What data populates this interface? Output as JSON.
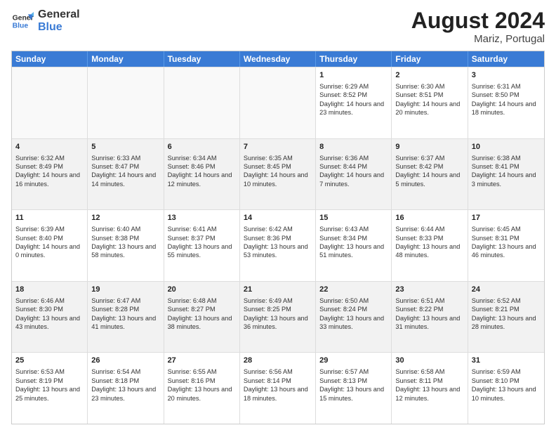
{
  "header": {
    "logo": "GeneralBlue",
    "month_year": "August 2024",
    "location": "Mariz, Portugal"
  },
  "days_of_week": [
    "Sunday",
    "Monday",
    "Tuesday",
    "Wednesday",
    "Thursday",
    "Friday",
    "Saturday"
  ],
  "rows": [
    [
      {
        "day": "",
        "info": ""
      },
      {
        "day": "",
        "info": ""
      },
      {
        "day": "",
        "info": ""
      },
      {
        "day": "",
        "info": ""
      },
      {
        "day": "1",
        "info": "Sunrise: 6:29 AM\nSunset: 8:52 PM\nDaylight: 14 hours and 23 minutes."
      },
      {
        "day": "2",
        "info": "Sunrise: 6:30 AM\nSunset: 8:51 PM\nDaylight: 14 hours and 20 minutes."
      },
      {
        "day": "3",
        "info": "Sunrise: 6:31 AM\nSunset: 8:50 PM\nDaylight: 14 hours and 18 minutes."
      }
    ],
    [
      {
        "day": "4",
        "info": "Sunrise: 6:32 AM\nSunset: 8:49 PM\nDaylight: 14 hours and 16 minutes."
      },
      {
        "day": "5",
        "info": "Sunrise: 6:33 AM\nSunset: 8:47 PM\nDaylight: 14 hours and 14 minutes."
      },
      {
        "day": "6",
        "info": "Sunrise: 6:34 AM\nSunset: 8:46 PM\nDaylight: 14 hours and 12 minutes."
      },
      {
        "day": "7",
        "info": "Sunrise: 6:35 AM\nSunset: 8:45 PM\nDaylight: 14 hours and 10 minutes."
      },
      {
        "day": "8",
        "info": "Sunrise: 6:36 AM\nSunset: 8:44 PM\nDaylight: 14 hours and 7 minutes."
      },
      {
        "day": "9",
        "info": "Sunrise: 6:37 AM\nSunset: 8:42 PM\nDaylight: 14 hours and 5 minutes."
      },
      {
        "day": "10",
        "info": "Sunrise: 6:38 AM\nSunset: 8:41 PM\nDaylight: 14 hours and 3 minutes."
      }
    ],
    [
      {
        "day": "11",
        "info": "Sunrise: 6:39 AM\nSunset: 8:40 PM\nDaylight: 14 hours and 0 minutes."
      },
      {
        "day": "12",
        "info": "Sunrise: 6:40 AM\nSunset: 8:38 PM\nDaylight: 13 hours and 58 minutes."
      },
      {
        "day": "13",
        "info": "Sunrise: 6:41 AM\nSunset: 8:37 PM\nDaylight: 13 hours and 55 minutes."
      },
      {
        "day": "14",
        "info": "Sunrise: 6:42 AM\nSunset: 8:36 PM\nDaylight: 13 hours and 53 minutes."
      },
      {
        "day": "15",
        "info": "Sunrise: 6:43 AM\nSunset: 8:34 PM\nDaylight: 13 hours and 51 minutes."
      },
      {
        "day": "16",
        "info": "Sunrise: 6:44 AM\nSunset: 8:33 PM\nDaylight: 13 hours and 48 minutes."
      },
      {
        "day": "17",
        "info": "Sunrise: 6:45 AM\nSunset: 8:31 PM\nDaylight: 13 hours and 46 minutes."
      }
    ],
    [
      {
        "day": "18",
        "info": "Sunrise: 6:46 AM\nSunset: 8:30 PM\nDaylight: 13 hours and 43 minutes."
      },
      {
        "day": "19",
        "info": "Sunrise: 6:47 AM\nSunset: 8:28 PM\nDaylight: 13 hours and 41 minutes."
      },
      {
        "day": "20",
        "info": "Sunrise: 6:48 AM\nSunset: 8:27 PM\nDaylight: 13 hours and 38 minutes."
      },
      {
        "day": "21",
        "info": "Sunrise: 6:49 AM\nSunset: 8:25 PM\nDaylight: 13 hours and 36 minutes."
      },
      {
        "day": "22",
        "info": "Sunrise: 6:50 AM\nSunset: 8:24 PM\nDaylight: 13 hours and 33 minutes."
      },
      {
        "day": "23",
        "info": "Sunrise: 6:51 AM\nSunset: 8:22 PM\nDaylight: 13 hours and 31 minutes."
      },
      {
        "day": "24",
        "info": "Sunrise: 6:52 AM\nSunset: 8:21 PM\nDaylight: 13 hours and 28 minutes."
      }
    ],
    [
      {
        "day": "25",
        "info": "Sunrise: 6:53 AM\nSunset: 8:19 PM\nDaylight: 13 hours and 25 minutes."
      },
      {
        "day": "26",
        "info": "Sunrise: 6:54 AM\nSunset: 8:18 PM\nDaylight: 13 hours and 23 minutes."
      },
      {
        "day": "27",
        "info": "Sunrise: 6:55 AM\nSunset: 8:16 PM\nDaylight: 13 hours and 20 minutes."
      },
      {
        "day": "28",
        "info": "Sunrise: 6:56 AM\nSunset: 8:14 PM\nDaylight: 13 hours and 18 minutes."
      },
      {
        "day": "29",
        "info": "Sunrise: 6:57 AM\nSunset: 8:13 PM\nDaylight: 13 hours and 15 minutes."
      },
      {
        "day": "30",
        "info": "Sunrise: 6:58 AM\nSunset: 8:11 PM\nDaylight: 13 hours and 12 minutes."
      },
      {
        "day": "31",
        "info": "Sunrise: 6:59 AM\nSunset: 8:10 PM\nDaylight: 13 hours and 10 minutes."
      }
    ]
  ]
}
